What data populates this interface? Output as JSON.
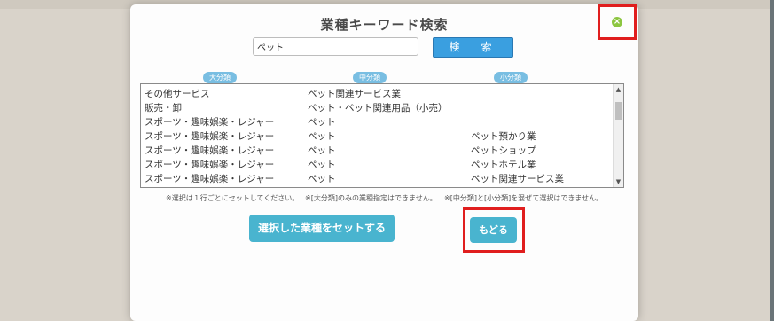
{
  "title": "業種キーワード検索",
  "search": {
    "value": "ペット",
    "button_label": "検　索"
  },
  "columns": {
    "large": "大分類",
    "medium": "中分類",
    "small": "小分類"
  },
  "rows": [
    {
      "large": "その他サービス",
      "medium": "ペット関連サービス業",
      "small": ""
    },
    {
      "large": "販売・卸",
      "medium": "ペット・ペット関連用品（小売）",
      "small": ""
    },
    {
      "large": "スポーツ・趣味娯楽・レジャー",
      "medium": "ペット",
      "small": ""
    },
    {
      "large": "スポーツ・趣味娯楽・レジャー",
      "medium": "ペット",
      "small": "ペット預かり業"
    },
    {
      "large": "スポーツ・趣味娯楽・レジャー",
      "medium": "ペット",
      "small": "ペットショップ"
    },
    {
      "large": "スポーツ・趣味娯楽・レジャー",
      "medium": "ペット",
      "small": "ペットホテル業"
    },
    {
      "large": "スポーツ・趣味娯楽・レジャー",
      "medium": "ペット",
      "small": "ペット関連サービス業"
    }
  ],
  "notes": [
    "※選択は１行ごとにセットしてください。",
    "※[大分類]のみの業種指定はできません。",
    "※[中分類]と[小分類]を混ぜて選択はできません。"
  ],
  "buttons": {
    "set": "選択した業種をセットする",
    "back": "もどる"
  },
  "icons": {
    "close": "close-circle-icon",
    "scroll_up": "triangle-up-icon",
    "scroll_down": "triangle-down-icon"
  },
  "colors": {
    "accent": "#3a9fe0",
    "button": "#49b4cf",
    "highlight": "#e01e1e",
    "close": "#8cc640"
  }
}
